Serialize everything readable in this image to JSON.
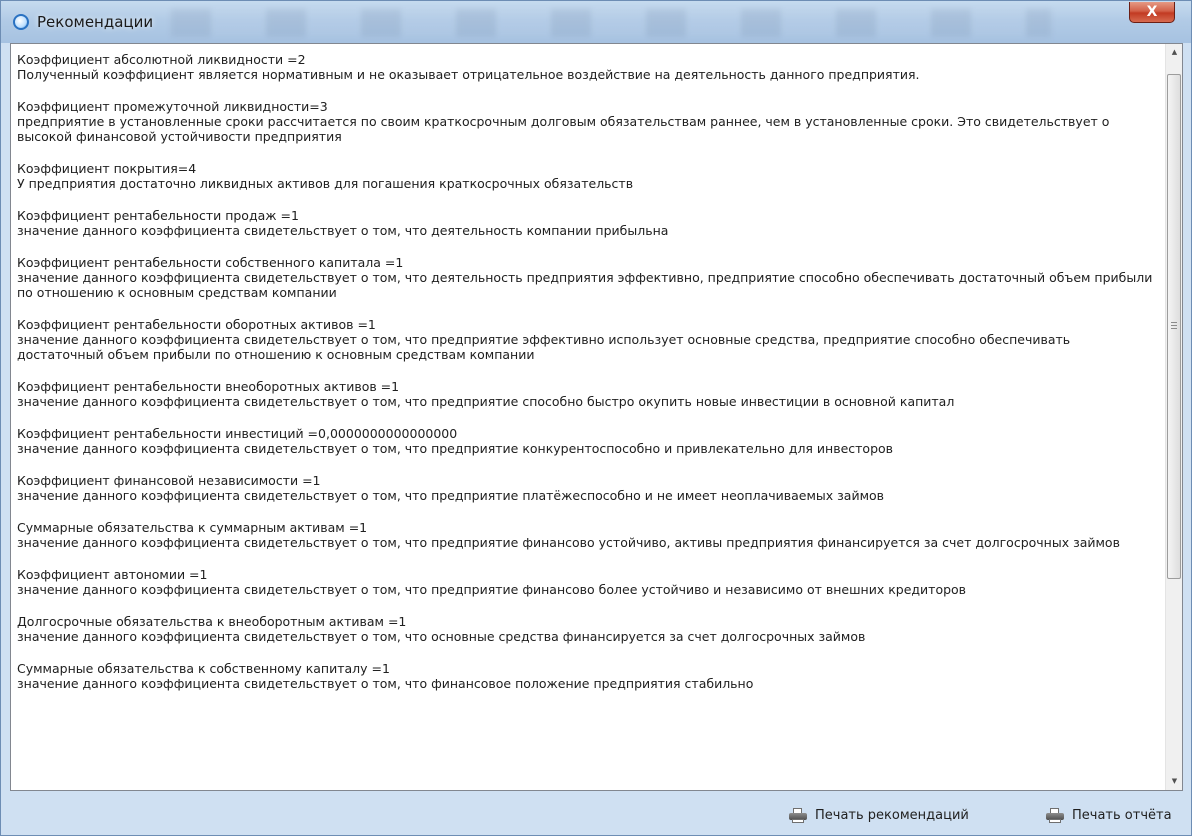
{
  "window": {
    "title": "Рекомендации",
    "close_label": "X"
  },
  "recommendations": [
    {
      "heading": "Коэффициент абсолютной ликвидности =2",
      "description": "Полученный коэффициент является нормативным и не оказывает отрицательное воздействие на деятельность данного предприятия."
    },
    {
      "heading": "Коэффициент промежуточной ликвидности=3",
      "description": "предприятие в установленные сроки рассчитается по своим краткосрочным долговым обязательствам раннее, чем в установленные сроки. Это свидетельствует о высокой финансовой устойчивости предприятия"
    },
    {
      "heading": "Коэффициент покрытия=4",
      "description": "У предприятия достаточно ликвидных активов для погашения краткосрочных обязательств"
    },
    {
      "heading": "Коэффициент рентабельности продаж =1",
      "description": "значение данного коэффициента свидетельствует о том, что деятельность компании прибыльна"
    },
    {
      "heading": "Коэффициент рентабельности собственного капитала =1",
      "description": "значение данного коэффициента свидетельствует о том, что деятельность предприятия эффективно, предприятие способно обеспечивать достаточный объем прибыли по отношению к основным средствам компании"
    },
    {
      "heading": "Коэффициент рентабельности оборотных активов =1",
      "description": "значение данного коэффициента свидетельствует о том, что предприятие эффективно использует основные средства, предприятие  способно обеспечивать достаточный объем прибыли по отношению к основным средствам компании"
    },
    {
      "heading": "Коэффициент рентабельности внеоборотных активов =1",
      "description": "значение данного коэффициента свидетельствует о том, что предприятие способно быстро окупить новые инвестиции в основной капитал"
    },
    {
      "heading": "Коэффициент рентабельности инвестиций =0,0000000000000000",
      "description": "значение данного коэффициента свидетельствует о том, что предприятие конкурентоспособно и привлекательно для инвесторов"
    },
    {
      "heading": "Коэффициент финансовой независимости =1",
      "description": "значение данного коэффициента свидетельствует о том, что предприятие платёжеспособно и не имеет неоплачиваемых займов"
    },
    {
      "heading": "Суммарные обязательства к суммарным активам =1",
      "description": "значение данного коэффициента свидетельствует о том, что предприятие финансово устойчиво, активы предприятия финансируется за счет долгосрочных займов"
    },
    {
      "heading": "Коэффициент автономии =1",
      "description": "значение данного коэффициента свидетельствует о том, что предприятие финансово более устойчиво и независимо от внешних кредиторов"
    },
    {
      "heading": "Долгосрочные обязательства к внеоборотным активам =1",
      "description": "значение данного коэффициента свидетельствует о том, что основные средства финансируется за счет долгосрочных займов"
    },
    {
      "heading": "Суммарные обязательства к собственному капиталу =1",
      "description": "значение данного коэффициента свидетельствует о том, что финансовое положение предприятия стабильно"
    }
  ],
  "footer": {
    "print_recommendations_label": "Печать рекомендаций",
    "print_report_label": "Печать отчёта",
    "print_icon": "printer-icon"
  },
  "colors": {
    "window_frame": "#cfe0f2",
    "close_button": "#c94b33"
  }
}
